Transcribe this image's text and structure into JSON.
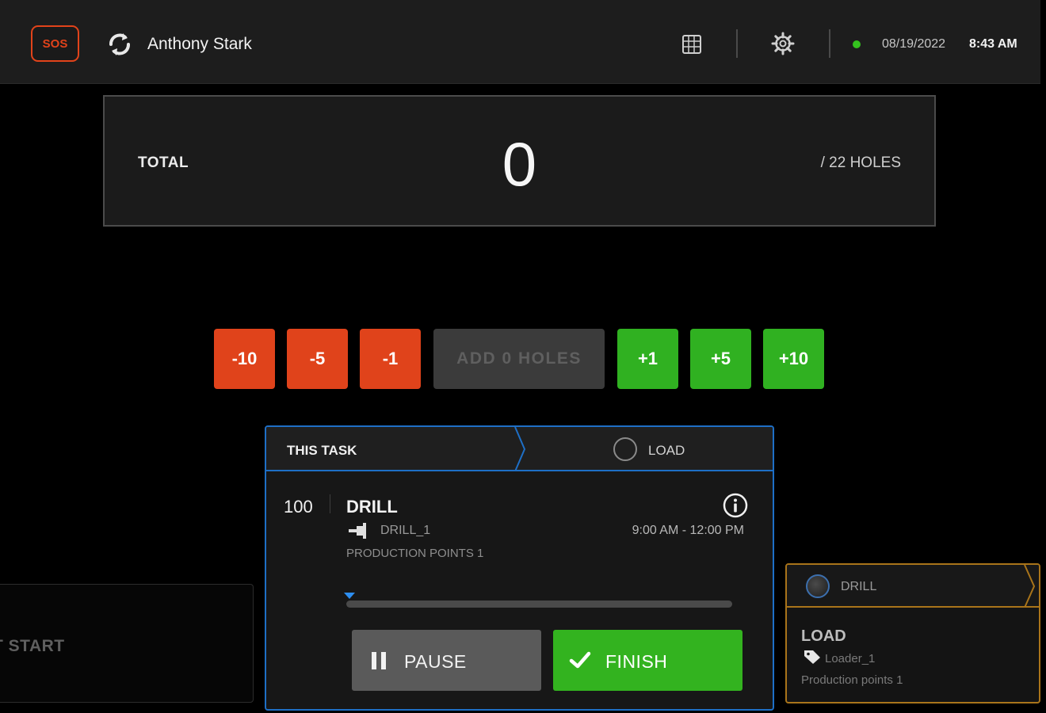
{
  "header": {
    "sos_label": "SOS",
    "user_name": "Anthony Stark",
    "date": "08/19/2022",
    "time": "8:43 AM",
    "icons": [
      "sync-icon",
      "grid-icon",
      "gear-icon"
    ],
    "status_color": "#34c21e"
  },
  "total": {
    "label": "TOTAL",
    "count": "0",
    "of_label": "/ 22 HOLES"
  },
  "counter": {
    "minus": [
      "-10",
      "-5",
      "-1"
    ],
    "add_label": "ADD 0 HOLES",
    "plus": [
      "+1",
      "+5",
      "+10"
    ]
  },
  "current_task": {
    "header_label": "THIS TASK",
    "next_step_label": "LOAD",
    "number": "100",
    "title": "DRILL",
    "machine": "DRILL_1",
    "timespan": "9:00 AM - 12:00 PM",
    "points": "PRODUCTION POINTS 1",
    "progress": 0,
    "pause_label": "PAUSE",
    "finish_label": "FINISH"
  },
  "previous_task": {
    "label": "T START"
  },
  "next_task": {
    "header_label": "DRILL",
    "title": "LOAD",
    "machine": "Loader_1",
    "points": "Production points 1"
  },
  "colors": {
    "danger": "#e0431b",
    "success": "#30b121",
    "accent_blue": "#1e6fc6",
    "accent_amber": "#a9741a"
  }
}
